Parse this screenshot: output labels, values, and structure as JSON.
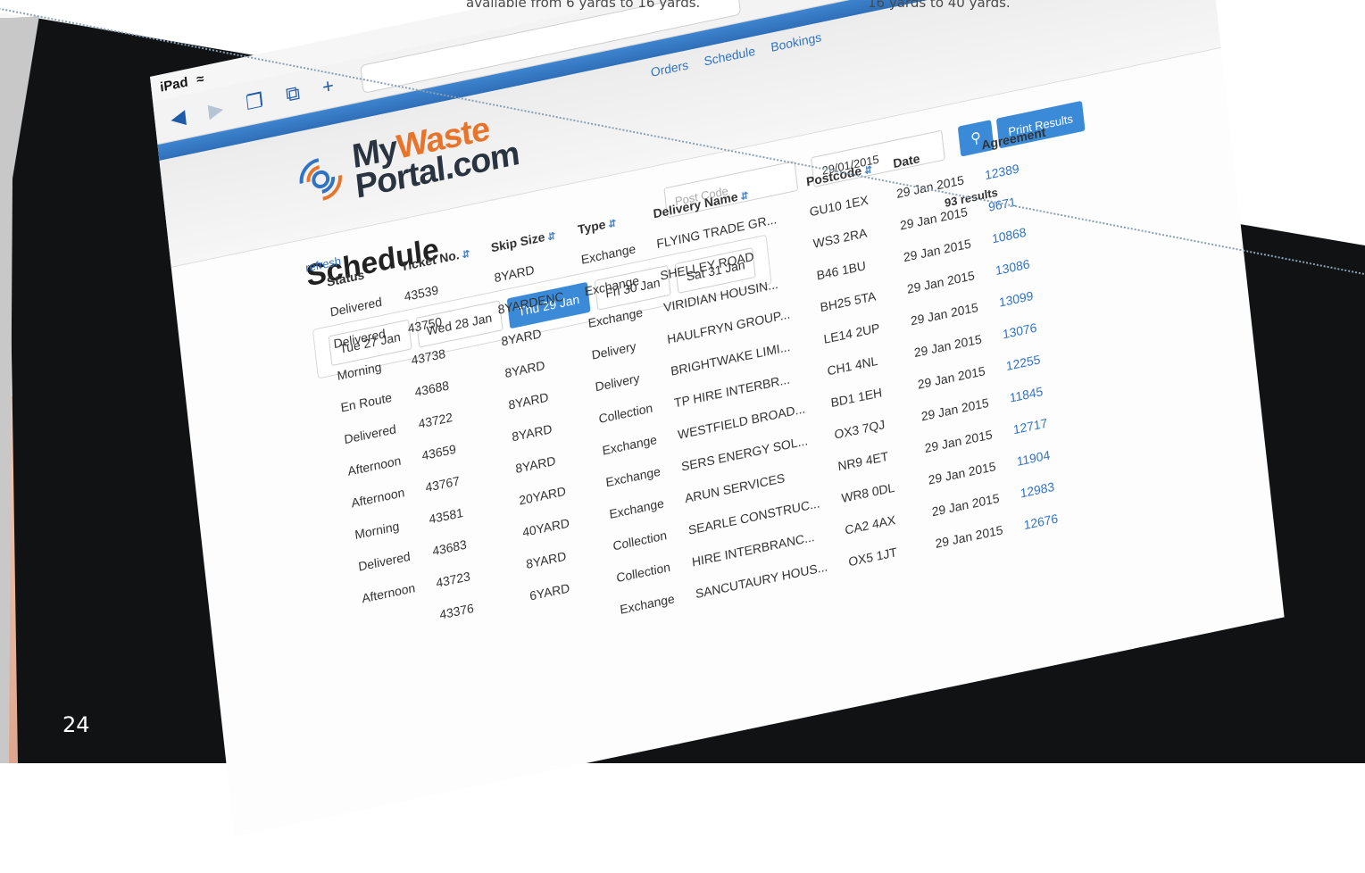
{
  "captions": {
    "left": "available from 6 yards to 16 yards.",
    "right": "16 yards to 40 yards."
  },
  "page_number": "24",
  "device": {
    "name": "iPad"
  },
  "site": {
    "logo_my": "My",
    "logo_waste": "Waste",
    "logo_portal": "Portal.com",
    "nav": [
      "Orders",
      "Schedule",
      "Bookings"
    ]
  },
  "schedule": {
    "title": "Schedule",
    "postcode_placeholder": "Post Code",
    "date_value": "29/01/2015",
    "print_label": "Print Results",
    "results": "93 results",
    "refresh": "refresh",
    "days": [
      {
        "label": "Tue 27 Jan",
        "active": false
      },
      {
        "label": "Wed 28 Jan",
        "active": false
      },
      {
        "label": "Thu 29 Jan",
        "active": true
      },
      {
        "label": "Fri 30 Jan",
        "active": false
      },
      {
        "label": "Sat 31 Jan",
        "active": false
      }
    ],
    "columns": [
      "Status",
      "Ticket No.",
      "Skip Size",
      "Type",
      "Delivery Name",
      "Postcode",
      "Date",
      "Agreement"
    ],
    "rows": [
      [
        "Delivered",
        "43539",
        "8YARD",
        "Exchange",
        "FLYING TRADE GR...",
        "GU10 1EX",
        "29 Jan 2015",
        "12389"
      ],
      [
        "Delivered",
        "43750",
        "8YARDENC",
        "Exchange",
        "SHELLEY ROAD",
        "WS3 2RA",
        "29 Jan 2015",
        "9671"
      ],
      [
        "Morning",
        "43738",
        "8YARD",
        "Exchange",
        "VIRIDIAN HOUSIN...",
        "B46 1BU",
        "29 Jan 2015",
        "10868"
      ],
      [
        "En Route",
        "43688",
        "8YARD",
        "Delivery",
        "HAULFRYN GROUP...",
        "BH25 5TA",
        "29 Jan 2015",
        "13086"
      ],
      [
        "Delivered",
        "43722",
        "8YARD",
        "Delivery",
        "BRIGHTWAKE LIMI...",
        "LE14 2UP",
        "29 Jan 2015",
        "13099"
      ],
      [
        "Afternoon",
        "43659",
        "8YARD",
        "Collection",
        "TP HIRE INTERBR...",
        "CH1 4NL",
        "29 Jan 2015",
        "13076"
      ],
      [
        "Afternoon",
        "43767",
        "8YARD",
        "Exchange",
        "WESTFIELD BROAD...",
        "BD1 1EH",
        "29 Jan 2015",
        "12255"
      ],
      [
        "Morning",
        "43581",
        "20YARD",
        "Exchange",
        "SERS ENERGY SOL...",
        "OX3 7QJ",
        "29 Jan 2015",
        "11845"
      ],
      [
        "Delivered",
        "43683",
        "40YARD",
        "Exchange",
        "ARUN SERVICES",
        "NR9 4ET",
        "29 Jan 2015",
        "12717"
      ],
      [
        "Afternoon",
        "43723",
        "8YARD",
        "Collection",
        "SEARLE CONSTRUC...",
        "WR8 0DL",
        "29 Jan 2015",
        "11904"
      ],
      [
        "",
        "43376",
        "6YARD",
        "Collection",
        "HIRE INTERBRANC...",
        "CA2 4AX",
        "29 Jan 2015",
        "12983"
      ],
      [
        "",
        "",
        "",
        "Exchange",
        "SANCUTAURY HOUS...",
        "OX5 1JT",
        "29 Jan 2015",
        "12676"
      ]
    ]
  },
  "colors": {
    "accent": "#3b8ad8",
    "brand_orange": "#e8742c",
    "link": "#2f73c4"
  }
}
